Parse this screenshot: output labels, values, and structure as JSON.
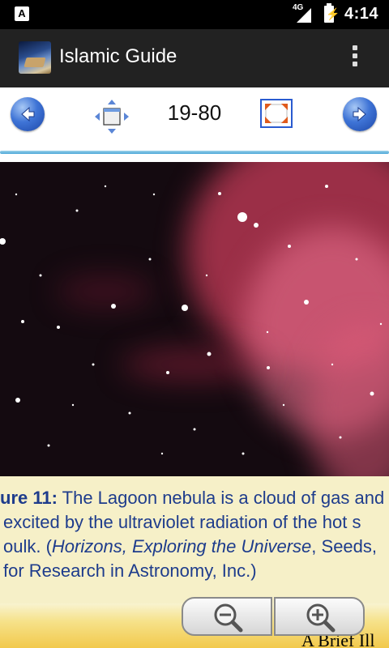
{
  "status_bar": {
    "network": "4G",
    "time": "4:14",
    "left_icon": "A"
  },
  "action_bar": {
    "title": "Islamic Guide",
    "overflow_icon": "more-vert-icon"
  },
  "toolbar": {
    "prev_icon": "arrow-left-icon",
    "move_icon": "move-icon",
    "page_indicator": "19-80",
    "fit_icon": "fit-screen-icon",
    "next_icon": "arrow-right-icon",
    "accent": "#3f74d6"
  },
  "document": {
    "caption": {
      "line1_bold": "ure 11:",
      "line1_rest": " The Lagoon nebula is a cloud of gas and",
      "line2": "excited by the ultraviolet radiation of the hot s",
      "line3_a": "oulk. (",
      "line3_italic": "Horizons, Exploring the Universe",
      "line3_b": ", Seeds,",
      "line4": "for Research in Astronomy, Inc.)"
    },
    "footer_text": "A Brief Ill"
  },
  "zoom": {
    "zoom_out_icon": "zoom-out-icon",
    "zoom_in_icon": "zoom-in-icon"
  }
}
